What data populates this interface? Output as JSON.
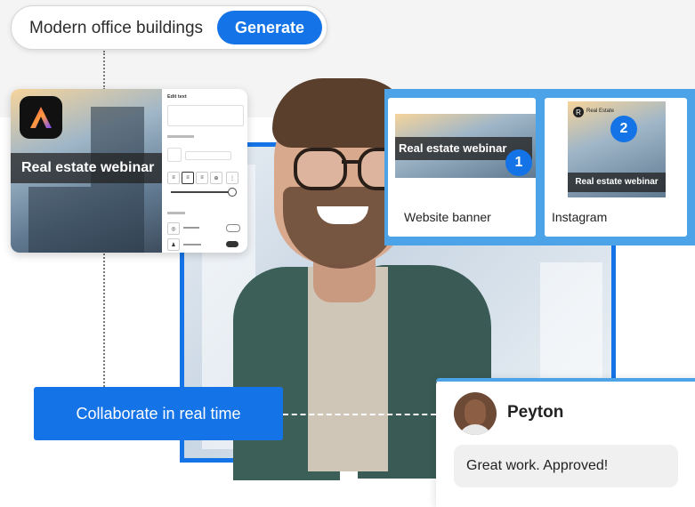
{
  "prompt_bar": {
    "prompt_text": "Modern office buildings",
    "generate_label": "Generate"
  },
  "editor_card": {
    "app_logo": "adobe-express-logo",
    "banner_text": "Real estate webinar",
    "panel": {
      "title": "Edit text"
    }
  },
  "outputs": [
    {
      "badge": "1",
      "banner_text": "Real estate webinar",
      "label": "Website banner"
    },
    {
      "badge": "2",
      "banner_text": "Real estate webinar",
      "brand_text": "Real Estate",
      "label": "Instagram"
    }
  ],
  "collaborate": {
    "label": "Collaborate in real time"
  },
  "comment": {
    "name": "Peyton",
    "message": "Great work. Approved!"
  },
  "colors": {
    "accent": "#1473e6",
    "light_blue": "#4da3e8",
    "band": "#f4f4f4"
  }
}
